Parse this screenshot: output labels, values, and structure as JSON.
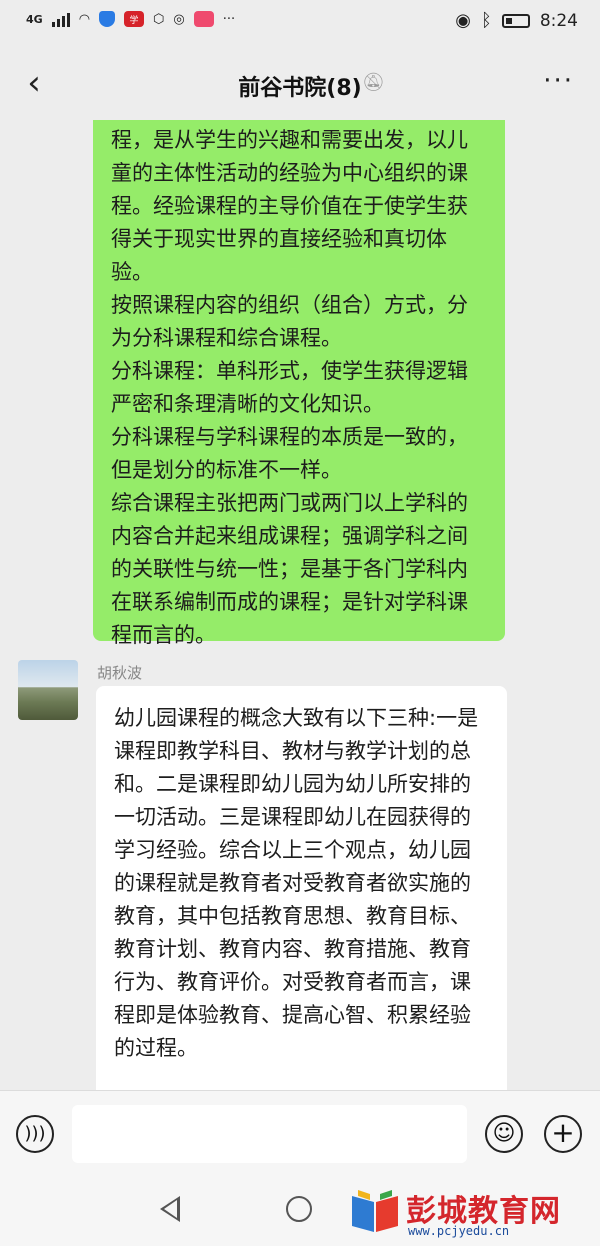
{
  "status_bar": {
    "network": "4G",
    "time": "8:24"
  },
  "header": {
    "title": "前谷书院(8)",
    "more_icon": "more-icon",
    "mute_icon": "bell-muted-icon"
  },
  "messages": {
    "self": {
      "text": "程，是从学生的兴趣和需要出发，以儿童的主体性活动的经验为中心组织的课程。经验课程的主导价值在于使学生获得关于现实世界的直接经验和真切体验。\n按照课程内容的组织（组合）方式，分为分科课程和综合课程。\n分科课程：单科形式，使学生获得逻辑严密和条理清晰的文化知识。\n分科课程与学科课程的本质是一致的，但是划分的标准不一样。\n综合课程主张把两门或两门以上学科的内容合并起来组成课程；强调学科之间的关联性与统一性；是基于各门学科内在联系编制而成的课程；是针对学科课程而言的。"
    },
    "other": {
      "sender": "胡秋波",
      "text": "幼儿园课程的概念大致有以下三种:一是课程即教学科目、教材与教学计划的总和。二是课程即幼儿园为幼儿所安排的一切活动。三是课程即幼儿在园获得的学习经验。综合以上三个观点，幼儿园的课程就是教育者对受教育者欲实施的教育，其中包括教育思想、教育目标、教育计划、教育内容、教育措施、教育行为、教育评价。对受教育者而言，课程即是体验教育、提高心智、积累经验的过程。"
    }
  },
  "watermark": {
    "name": "彭城教育网",
    "url": "www.pcjyedu.cn"
  },
  "colors": {
    "self_bubble": "#95ec69",
    "other_bubble": "#ffffff",
    "background": "#ededed"
  }
}
